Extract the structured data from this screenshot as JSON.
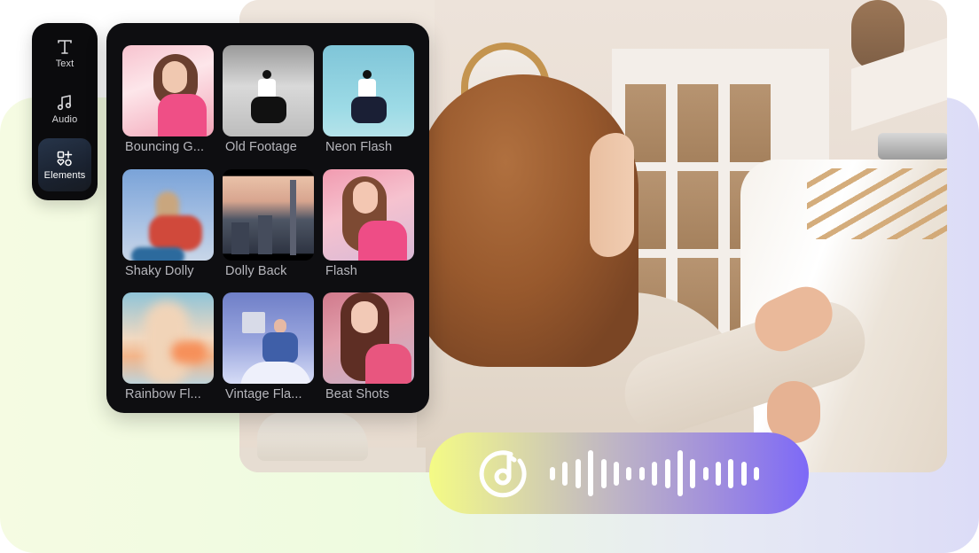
{
  "tool_rail": {
    "items": [
      {
        "label": "Text",
        "icon": "text-icon",
        "active": false
      },
      {
        "label": "Audio",
        "icon": "music-note-icon",
        "active": false
      },
      {
        "label": "Elements",
        "icon": "elements-icon",
        "active": true
      }
    ]
  },
  "effects_panel": {
    "items": [
      {
        "label": "Bouncing G...",
        "thumb": "bouncing"
      },
      {
        "label": "Old Footage",
        "thumb": "old"
      },
      {
        "label": "Neon Flash",
        "thumb": "neon"
      },
      {
        "label": "Shaky Dolly",
        "thumb": "shaky"
      },
      {
        "label": "Dolly Back",
        "thumb": "dolly"
      },
      {
        "label": "Flash",
        "thumb": "flash"
      },
      {
        "label": "Rainbow Fl...",
        "thumb": "rainbow"
      },
      {
        "label": "Vintage Fla...",
        "thumb": "vintage"
      },
      {
        "label": "Beat Shots",
        "thumb": "beat"
      }
    ]
  },
  "audio_pill": {
    "icon": "music-disc-icon",
    "waveform_levels": [
      0.28,
      0.52,
      0.64,
      1.0,
      0.64,
      0.52,
      0.28,
      0.28,
      0.52,
      0.64,
      1.0,
      0.64,
      0.28,
      0.52,
      0.64,
      0.52,
      0.28
    ],
    "gradient_start": "#f4fb85",
    "gradient_end": "#7d69f7"
  },
  "colors": {
    "panel_bg": "#0e0e11",
    "label_text": "#b7b7bd",
    "active_tool_bg": "#27354a"
  }
}
